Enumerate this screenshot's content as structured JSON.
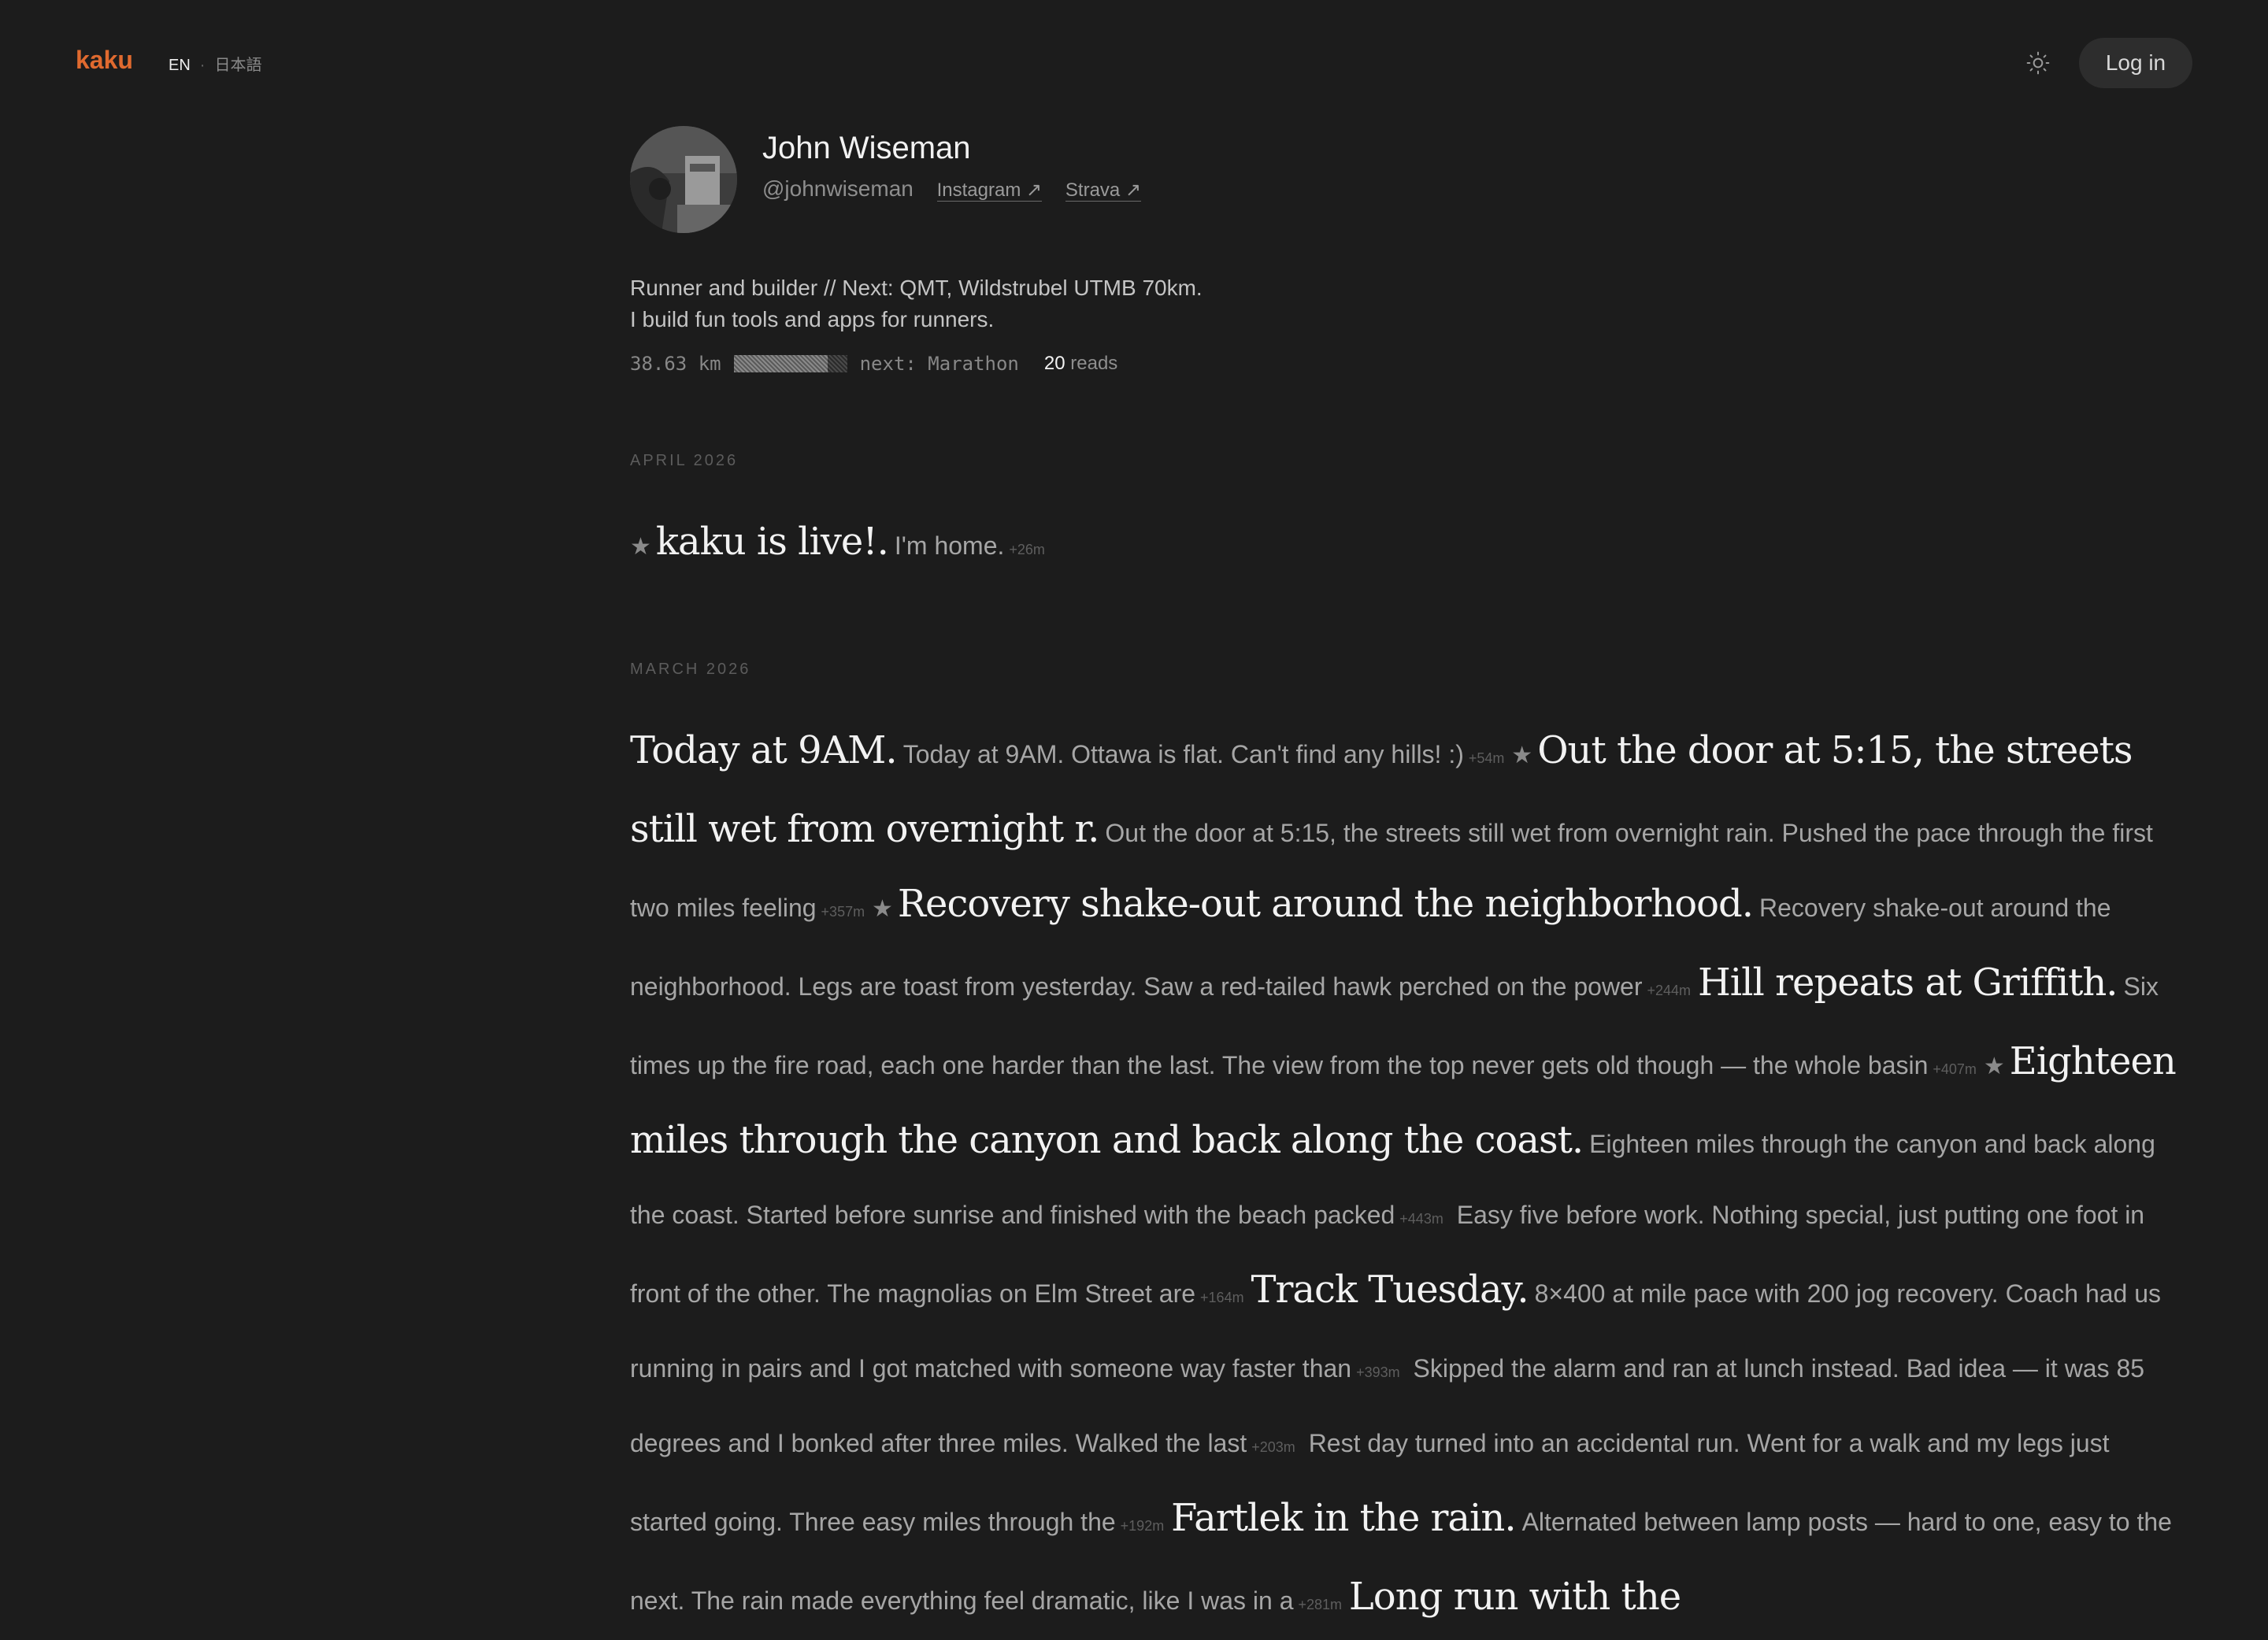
{
  "header": {
    "logo": "kaku",
    "lang_active": "EN",
    "lang_separator": "·",
    "lang_other": "日本語",
    "theme_icon": "sun-icon",
    "login_label": "Log in"
  },
  "profile": {
    "name": "John Wiseman",
    "handle": "@johnwiseman",
    "links": [
      "Instagram ↗",
      "Strava ↗"
    ],
    "bio_line1": "Runner and builder // Next: QMT, Wildstrubel UTMB 70km.",
    "bio_line2": "I build fun tools and apps for runners.",
    "distance": "38.63 km",
    "progress_fraction": 0.83,
    "next_label": "next: Marathon",
    "reads_count": "20",
    "reads_label": "reads"
  },
  "sections": {
    "april_label": "APRIL 2026",
    "march_label": "MARCH 2026"
  },
  "april_posts": [
    {
      "star": "★",
      "title": "kaku is live!.",
      "body": "I'm home.",
      "meta": "+26m"
    }
  ],
  "march_posts": [
    {
      "star": "",
      "title": "Today at 9AM.",
      "body": "Today at 9AM. Ottawa is flat. Can't find any hills! :)",
      "meta": "+54m"
    },
    {
      "star": "★",
      "title": "Out the door at 5:15, the streets still wet from overnight r.",
      "body": "Out the door at 5:15, the streets still wet from overnight rain. Pushed the pace through the first two miles feeling",
      "meta": "+357m"
    },
    {
      "star": "★",
      "title": "Recovery shake-out around the neighborhood.",
      "body": "Recovery shake-out around the neighborhood. Legs are toast from yesterday. Saw a red-tailed hawk perched on the power",
      "meta": "+244m"
    },
    {
      "star": "",
      "title": "Hill repeats at Griffith.",
      "body": "Six times up the fire road, each one harder than the last. The view from the top never gets old though — the whole basin",
      "meta": "+407m"
    },
    {
      "star": "★",
      "title": "Eighteen miles through the canyon and back along the coast.",
      "body": "Eighteen miles through the canyon and back along the coast. Started before sunrise and finished with the beach packed",
      "meta": "+443m"
    },
    {
      "star": "",
      "title": "",
      "body": "Easy five before work. Nothing special, just putting one foot in front of the other. The magnolias on Elm Street are",
      "meta": "+164m"
    },
    {
      "star": "",
      "title": "Track Tuesday.",
      "body": "8×400 at mile pace with 200 jog recovery. Coach had us running in pairs and I got matched with someone way faster than",
      "meta": "+393m"
    },
    {
      "star": "",
      "title": "",
      "body": "Skipped the alarm and ran at lunch instead. Bad idea — it was 85 degrees and I bonked after three miles. Walked the last",
      "meta": "+203m"
    },
    {
      "star": "",
      "title": "",
      "body": "Rest day turned into an accidental run. Went for a walk and my legs just started going. Three easy miles through the",
      "meta": "+192m"
    },
    {
      "star": "",
      "title": "Fartlek in the rain.",
      "body": "Alternated between lamp posts — hard to one, easy to the next. The rain made everything feel dramatic, like I was in a",
      "meta": "+281m"
    },
    {
      "star": "",
      "title": "Long run with the",
      "body": "",
      "meta": ""
    }
  ]
}
